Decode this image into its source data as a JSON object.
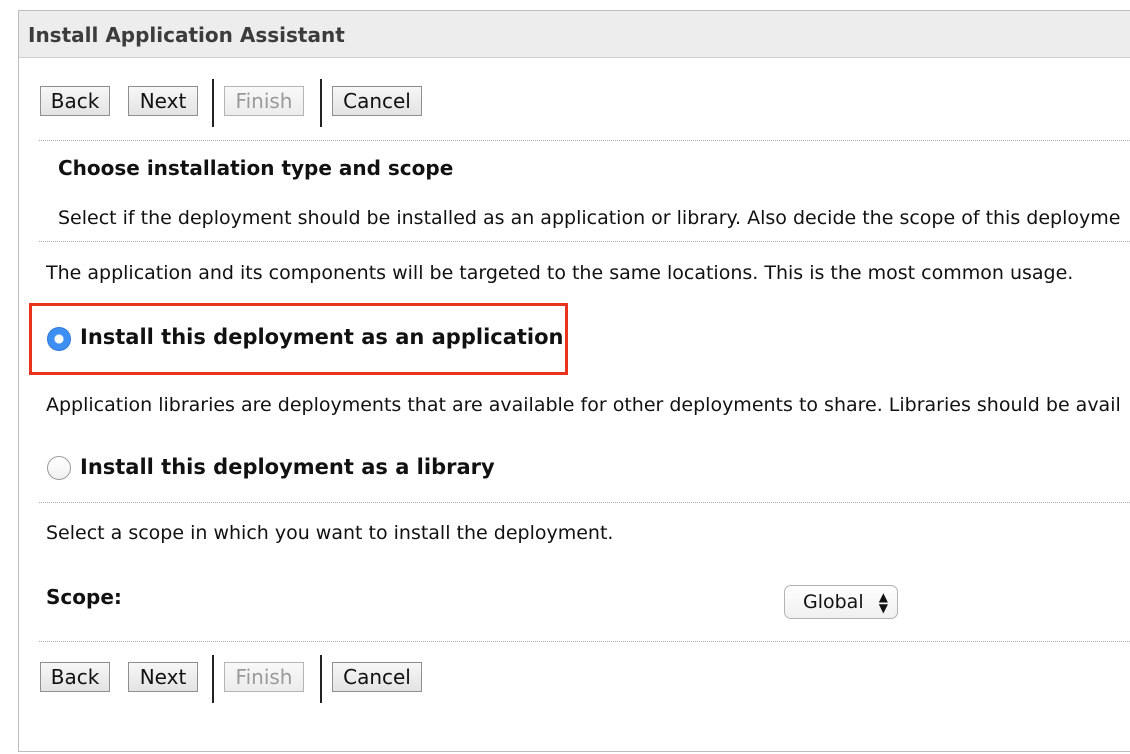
{
  "window": {
    "title": "Install Application Assistant"
  },
  "buttons": {
    "back": "Back",
    "next": "Next",
    "finish": "Finish",
    "cancel": "Cancel"
  },
  "section": {
    "heading": "Choose installation type and scope",
    "description": "Select if the deployment should be installed as an application or library. Also decide the scope of this deployme"
  },
  "application_option": {
    "description": "The application and its components will be targeted to the same locations. This is the most common usage.",
    "label": "Install this deployment as an application",
    "selected": true
  },
  "library_option": {
    "description": "Application libraries are deployments that are available for other deployments to share. Libraries should be avail",
    "label": "Install this deployment as a library",
    "selected": false
  },
  "scope": {
    "description": "Select a scope in which you want to install the deployment.",
    "label": "Scope:",
    "value": "Global"
  },
  "colors": {
    "highlight_border": "#e8341c",
    "radio_selected": "#3d8ff2"
  },
  "icons": {
    "select_arrows": "up-down-arrows-icon"
  }
}
